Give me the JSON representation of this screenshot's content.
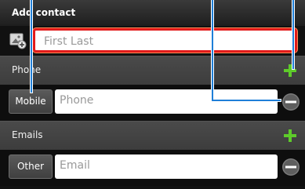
{
  "titlebar": {
    "title": "Add contact"
  },
  "name": {
    "placeholder": "First Last"
  },
  "phone": {
    "section_label": "Phone",
    "type_label": "Mobile",
    "placeholder": "Phone"
  },
  "emails": {
    "section_label": "Emails",
    "type_label": "Other",
    "placeholder": "Email"
  },
  "icons": {
    "photo": "contact-photo-icon",
    "add": "plus-icon",
    "remove": "minus-icon"
  },
  "colors": {
    "accent_green": "#5ecb2a",
    "focus_red": "#e21b1b",
    "callout_blue": "#1f7fd8"
  }
}
